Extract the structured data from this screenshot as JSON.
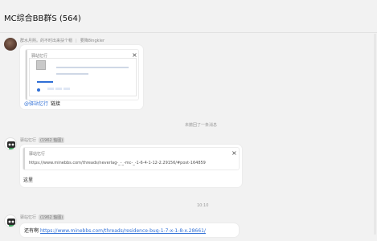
{
  "window": {
    "title": "MC综合BB群S (564)"
  },
  "messages": [
    {
      "sender_meta": "群水月熙。的不时出来扶个帽",
      "sender_meta_extra": "要降8ingkler",
      "quote_name": "驿站忆行",
      "mention": "@驿站忆行",
      "text": "链接"
    },
    {
      "center_note": "未撤回了一条消息"
    },
    {
      "sender_name": "驿站忆行",
      "sender_tag": "(1962 轴图)",
      "quote_name": "驿站忆行",
      "quote_text": "https://www.minebbs.com/threads/neverlag-_-_-mc-_-1-6-4-1-12-2.29156/#post-164859",
      "text": "这里"
    },
    {
      "center_note": "10:10"
    },
    {
      "sender_name": "驿站忆行",
      "sender_tag": "(1962 轴图)",
      "text_prefix": "还有啊",
      "link": "https://www.minebbs.com/threads/residence-bug-1-7-x-1-8-x.28661/"
    }
  ],
  "icons": {
    "close": "close-icon",
    "avatar_photo": "user-avatar",
    "avatar_robot": "robot-avatar"
  },
  "colors": {
    "background": "#f2f2f2",
    "link": "#2f6fd6",
    "bubble": "#ffffff"
  }
}
